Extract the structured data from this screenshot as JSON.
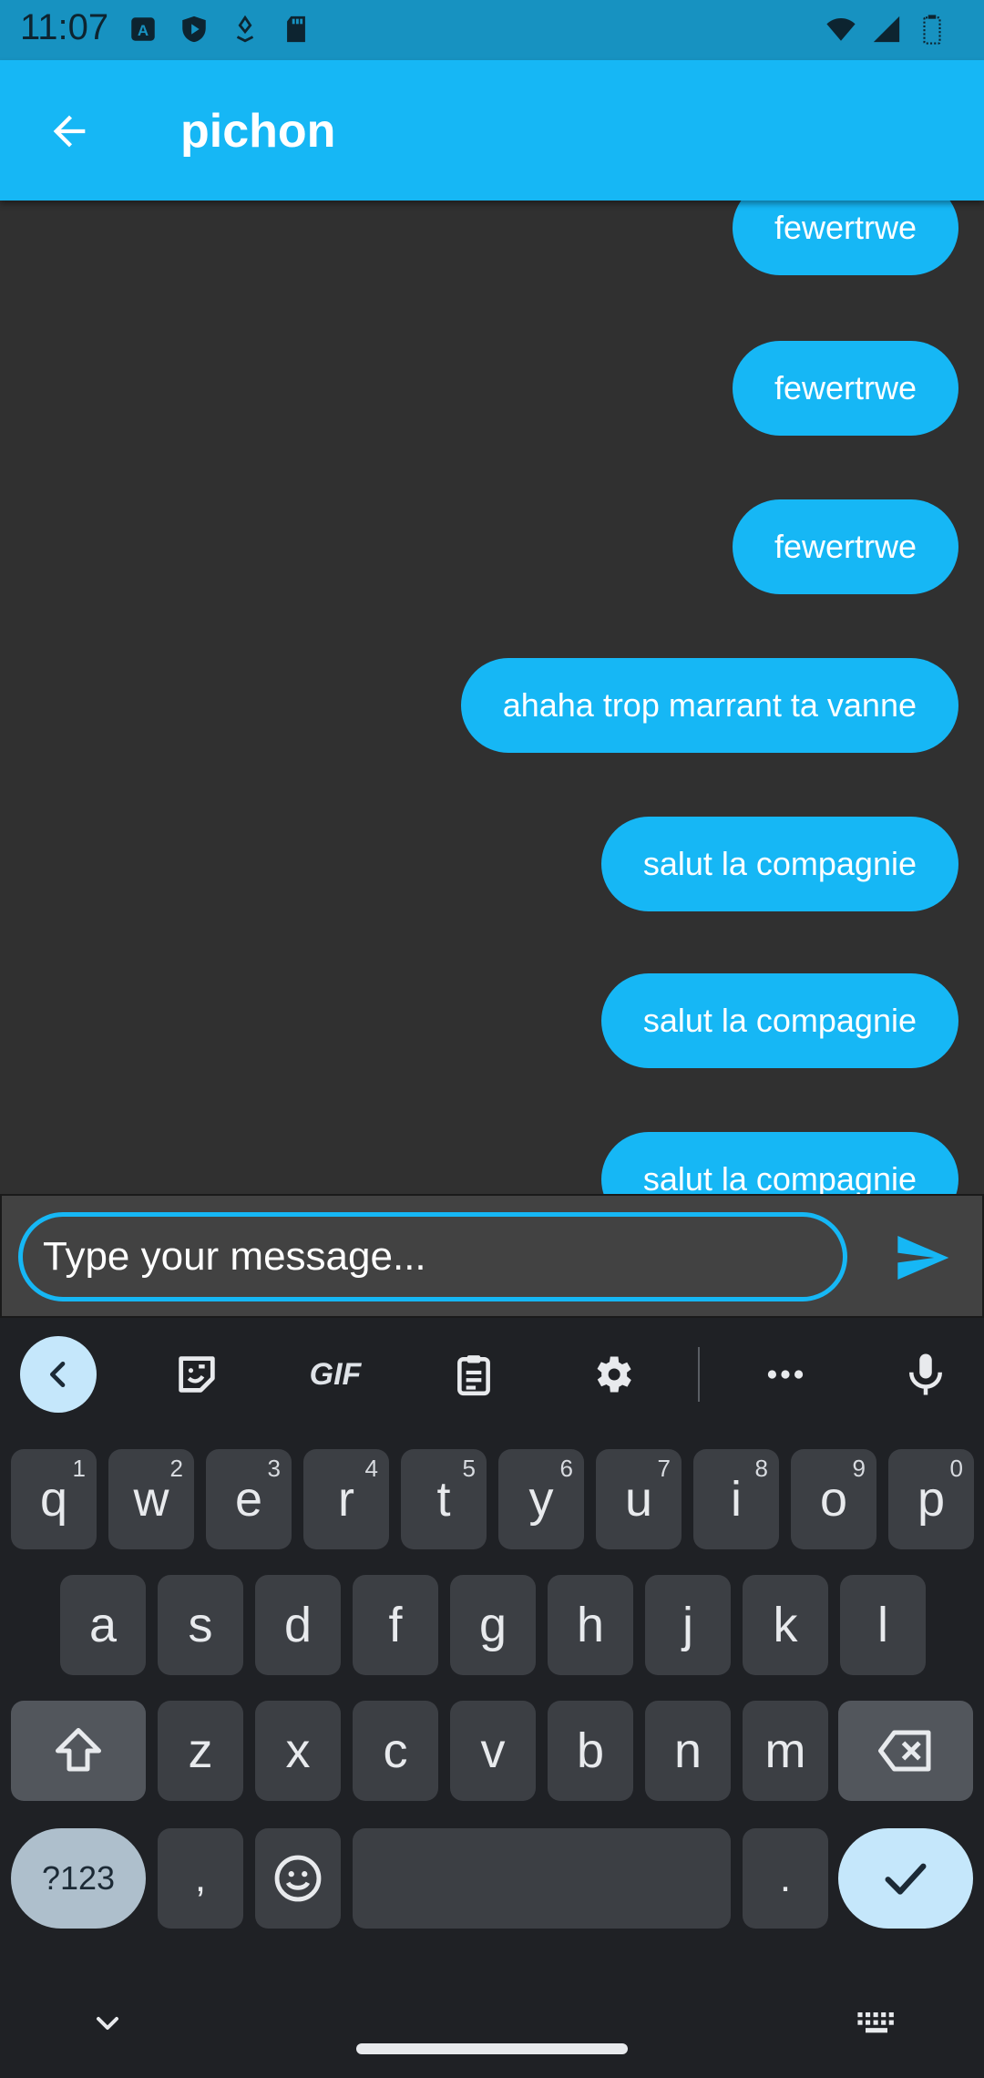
{
  "status_bar": {
    "time": "11:07"
  },
  "app_bar": {
    "title": "pichon"
  },
  "messages": [
    {
      "text": "fewertrwe"
    },
    {
      "text": "fewertrwe"
    },
    {
      "text": "fewertrwe"
    },
    {
      "text": "ahaha trop marrant ta vanne"
    },
    {
      "text": "salut la compagnie"
    },
    {
      "text": "salut la compagnie"
    },
    {
      "text": "salut la compagnie"
    }
  ],
  "composer": {
    "placeholder": "Type your message..."
  },
  "keyboard": {
    "toolbar": {
      "gif_label": "GIF"
    },
    "row1": [
      {
        "key": "q",
        "hint": "1"
      },
      {
        "key": "w",
        "hint": "2"
      },
      {
        "key": "e",
        "hint": "3"
      },
      {
        "key": "r",
        "hint": "4"
      },
      {
        "key": "t",
        "hint": "5"
      },
      {
        "key": "y",
        "hint": "6"
      },
      {
        "key": "u",
        "hint": "7"
      },
      {
        "key": "i",
        "hint": "8"
      },
      {
        "key": "o",
        "hint": "9"
      },
      {
        "key": "p",
        "hint": "0"
      }
    ],
    "row2": [
      "a",
      "s",
      "d",
      "f",
      "g",
      "h",
      "j",
      "k",
      "l"
    ],
    "row3": [
      "z",
      "x",
      "c",
      "v",
      "b",
      "n",
      "m"
    ],
    "row4": {
      "symbols": "?123",
      "comma": ",",
      "period": "."
    }
  },
  "colors": {
    "accent": "#16b7f5",
    "status_bar": "#1792c1",
    "chat_background": "#303030",
    "keyboard_background": "#1f2125"
  }
}
